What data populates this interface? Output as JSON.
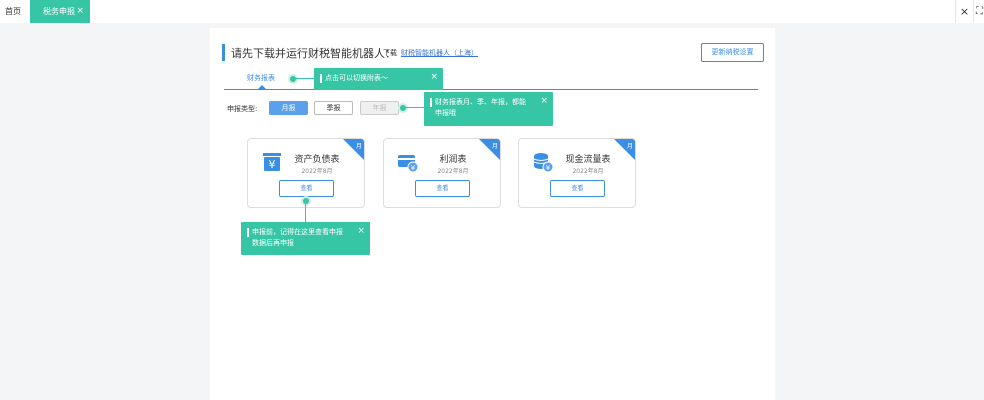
{
  "tabbar": {
    "home_label": "首页",
    "active_tab_label": "税务申报",
    "active_tab_close": "×",
    "close_glyph": "×",
    "fullscreen_glyph": "⛶"
  },
  "header": {
    "title": "请先下载并运行财税智能机器人：",
    "download_label": "下载",
    "download_link": "财税智能机器人（上海）",
    "update_button": "更新纳税设置"
  },
  "tabs": {
    "finance_label": "财务报表"
  },
  "tips": {
    "switch_tip": "点击可以切换附表～",
    "period_tip_line1": "财务报表月、季、年报，都能",
    "period_tip_line2": "申报哦",
    "view_tip_line1": "申报前，记得在这里查看申报",
    "view_tip_line2": "数据后再申报",
    "close_glyph": "×"
  },
  "period": {
    "label": "申报类型:",
    "options": [
      "月报",
      "季报",
      "年报"
    ],
    "selected": "月报"
  },
  "cards": [
    {
      "name": "资产负债表",
      "date": "2022年8月",
      "badge": "月",
      "button": "查看",
      "icon": "yen-icon"
    },
    {
      "name": "利润表",
      "date": "2022年8月",
      "badge": "月",
      "button": "查看",
      "icon": "wallet-icon"
    },
    {
      "name": "现金流量表",
      "date": "2022年8月",
      "badge": "月",
      "button": "查看",
      "icon": "coins-icon"
    }
  ],
  "colors": {
    "accent": "#3a8ee6",
    "tip": "#36c5a5"
  }
}
